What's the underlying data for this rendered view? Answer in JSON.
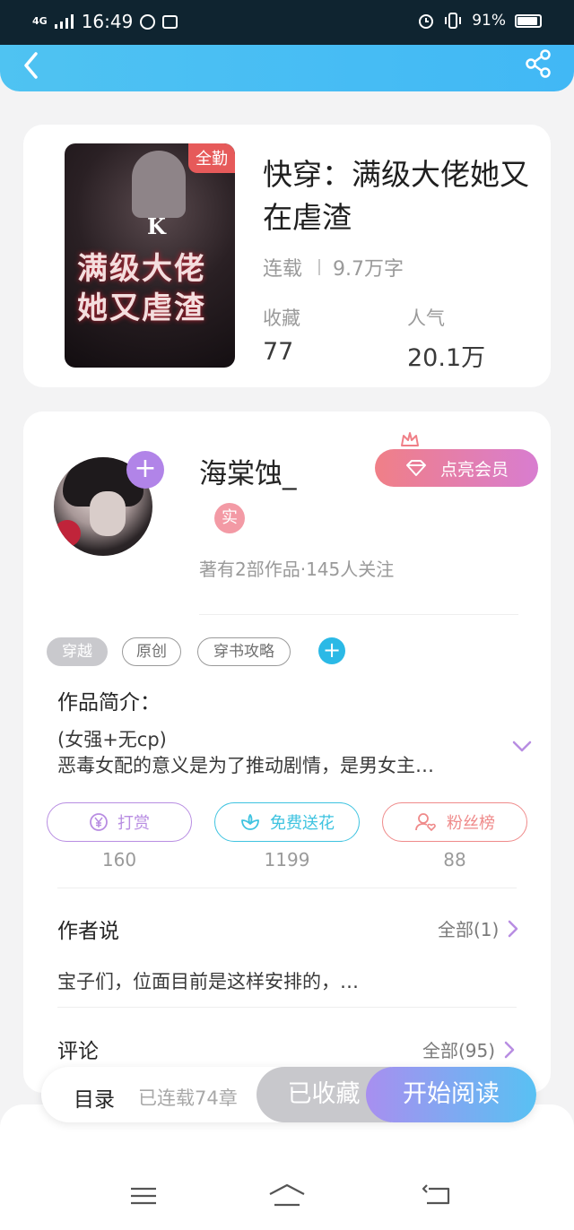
{
  "status_bar": {
    "network": "4G",
    "time": "16:49",
    "battery": "91%"
  },
  "book": {
    "title": "快穿：满级大佬她又在虐渣",
    "badge": "全勤",
    "cover_title": "满级大佬她又虐渣",
    "cover_letter": "K",
    "status": "连载",
    "word_count": "9.7万字",
    "favorites_label": "收藏",
    "favorites_value": "77",
    "popularity_label": "人气",
    "popularity_value": "20.1万"
  },
  "author": {
    "name": "海棠蚀_",
    "verified_badge": "实",
    "stats": "著有2部作品·145人关注",
    "vip_button": "点亮会员"
  },
  "tags": [
    "穿越",
    "原创",
    "穿书攻略"
  ],
  "intro": {
    "title": "作品简介：",
    "line1": "(女强+无cp)",
    "line2": "恶毒女配的意义是为了推动剧情，是男女主…"
  },
  "actions": [
    {
      "label": "打赏",
      "count": "160",
      "color": "#b88de2"
    },
    {
      "label": "免费送花",
      "count": "1199",
      "color": "#3ec3e0"
    },
    {
      "label": "粉丝榜",
      "count": "88",
      "color": "#ef8a8a"
    }
  ],
  "author_say": {
    "title": "作者说",
    "all": "全部(1)",
    "text": "宝子们，位面目前是这样安排的，…"
  },
  "comments": {
    "title": "评论",
    "all": "全部(95)"
  },
  "bottom_bar": {
    "toc": "目录",
    "chapters": "已连载74章",
    "collected": "已收藏",
    "start_read": "开始阅读"
  }
}
